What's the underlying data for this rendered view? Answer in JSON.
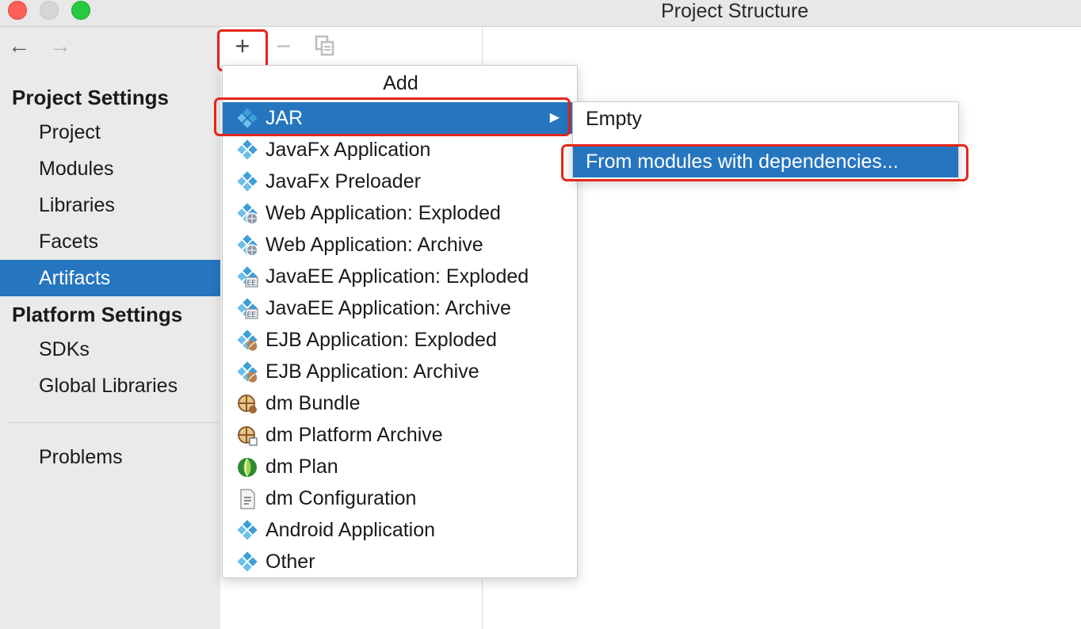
{
  "window": {
    "title": "Project Structure"
  },
  "nav": {
    "back_glyph": "←",
    "forward_glyph": "→"
  },
  "sidebar": {
    "project_settings_title": "Project Settings",
    "platform_settings_title": "Platform Settings",
    "items": [
      {
        "label": "Project",
        "selected": false
      },
      {
        "label": "Modules",
        "selected": false
      },
      {
        "label": "Libraries",
        "selected": false
      },
      {
        "label": "Facets",
        "selected": false
      },
      {
        "label": "Artifacts",
        "selected": true
      },
      {
        "label": "SDKs",
        "selected": false
      },
      {
        "label": "Global Libraries",
        "selected": false
      },
      {
        "label": "Problems",
        "selected": false
      }
    ]
  },
  "toolbar": {
    "add_glyph": "+",
    "remove_glyph": "−",
    "add_icon": "plus-icon",
    "remove_icon": "minus-icon",
    "copy_icon": "copy-icon"
  },
  "add_menu": {
    "title": "Add",
    "items": [
      {
        "label": "JAR",
        "icon": "jar-icon",
        "active": true,
        "has_submenu": true
      },
      {
        "label": "JavaFx Application",
        "icon": "javafx-app-icon"
      },
      {
        "label": "JavaFx Preloader",
        "icon": "javafx-preloader-icon"
      },
      {
        "label": "Web Application: Exploded",
        "icon": "web-app-exploded-icon"
      },
      {
        "label": "Web Application: Archive",
        "icon": "web-app-archive-icon"
      },
      {
        "label": "JavaEE Application: Exploded",
        "icon": "javaee-exploded-icon"
      },
      {
        "label": "JavaEE Application: Archive",
        "icon": "javaee-archive-icon"
      },
      {
        "label": "EJB Application: Exploded",
        "icon": "ejb-exploded-icon"
      },
      {
        "label": "EJB Application: Archive",
        "icon": "ejb-archive-icon"
      },
      {
        "label": "dm Bundle",
        "icon": "dm-bundle-icon"
      },
      {
        "label": "dm Platform Archive",
        "icon": "dm-platform-archive-icon"
      },
      {
        "label": "dm Plan",
        "icon": "dm-plan-icon"
      },
      {
        "label": "dm Configuration",
        "icon": "dm-configuration-icon"
      },
      {
        "label": "Android Application",
        "icon": "android-app-icon"
      },
      {
        "label": "Other",
        "icon": "other-artifact-icon"
      }
    ],
    "submenu_arrow": "▶"
  },
  "jar_submenu": {
    "items": [
      {
        "label": "Empty",
        "active": false
      },
      {
        "label": "From modules with dependencies...",
        "active": true
      }
    ]
  },
  "colors": {
    "selection": "#2675bf",
    "highlight_box": "#e5261a",
    "artifact_icon_blue": "#3d9fd7"
  }
}
